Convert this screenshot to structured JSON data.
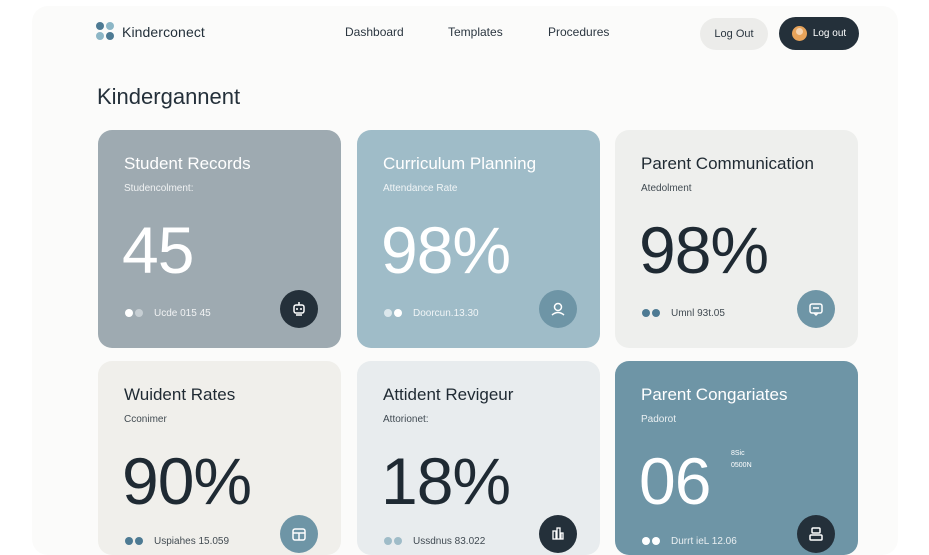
{
  "app": {
    "name": "Kinderconect"
  },
  "nav": {
    "items": [
      "Dashboard",
      "Templates",
      "Procedures"
    ]
  },
  "header": {
    "log_out_light": "Log Out",
    "log_out_dark": "Log out"
  },
  "page": {
    "title": "Kindergannent"
  },
  "cards": [
    {
      "title": "Student Records",
      "subtitle": "Studencolment:",
      "value": "45",
      "footer": "Ucde 015 45",
      "icon": "robot-icon"
    },
    {
      "title": "Curriculum Planning",
      "subtitle": "Attendance Rate",
      "value": "98%",
      "footer": "Doorcun.13.30",
      "icon": "user-icon"
    },
    {
      "title": "Parent Communication",
      "subtitle": "Atedolment",
      "value": "98%",
      "footer": "Umnl 93t.05",
      "icon": "chat-icon"
    },
    {
      "title": "Wuident Rates",
      "subtitle": "Cconimer",
      "value": "90%",
      "footer": "Uspiahes 15.059",
      "icon": "calendar-icon"
    },
    {
      "title": "Attident Revigeur",
      "subtitle": "Attorionet:",
      "value": "18%",
      "footer": "Ussdnus 83.022",
      "icon": "chart-icon"
    },
    {
      "title": "Parent Congariates",
      "subtitle": "Padorot",
      "value": "06",
      "side_top": "8Sic",
      "side_bottom": "0500N",
      "footer": "Durrt ieL 12.06",
      "icon": "document-icon"
    }
  ],
  "colors": {
    "card_1": "#9eaab1",
    "card_2": "#9fbcc8",
    "card_3": "#eeefed",
    "card_4": "#f0efeb",
    "card_5": "#e8ecee",
    "card_6": "#6e95a6",
    "dark": "#24303a"
  }
}
